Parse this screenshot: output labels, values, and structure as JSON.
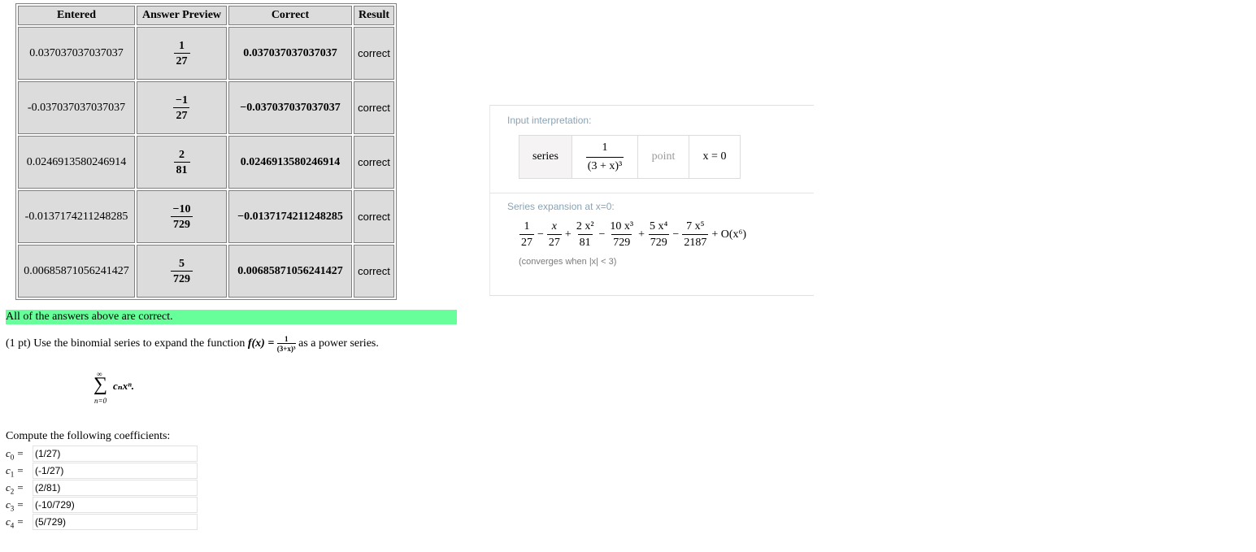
{
  "table": {
    "headers": [
      "Entered",
      "Answer Preview",
      "Correct",
      "Result"
    ],
    "rows": [
      {
        "entered": "0.037037037037037",
        "preview_num": "1",
        "preview_den": "27",
        "correct": "0.037037037037037",
        "result": "correct"
      },
      {
        "entered": "-0.037037037037037",
        "preview_num": "−1",
        "preview_den": "27",
        "correct": "−0.037037037037037",
        "result": "correct"
      },
      {
        "entered": "0.0246913580246914",
        "preview_num": "2",
        "preview_den": "81",
        "correct": "0.0246913580246914",
        "result": "correct"
      },
      {
        "entered": "-0.0137174211248285",
        "preview_num": "−10",
        "preview_den": "729",
        "correct": "−0.0137174211248285",
        "result": "correct"
      },
      {
        "entered": "0.00685871056241427",
        "preview_num": "5",
        "preview_den": "729",
        "correct": "0.00685871056241427",
        "result": "correct"
      }
    ]
  },
  "message": "All of the answers above are correct.",
  "problem": {
    "prefix": "(1 pt) Use the binomial series to expand the function ",
    "func": "f(x) = ",
    "func_num": "1",
    "func_den": "(3+x)³",
    "suffix": " as a power series.",
    "sum_upper": "∞",
    "sum_lower": "n=0",
    "sum_term": "cₙxⁿ."
  },
  "compute_label": "Compute the following coefficients:",
  "coefficients": [
    {
      "label": "c",
      "sub": "0",
      "value": "(1/27)"
    },
    {
      "label": "c",
      "sub": "1",
      "value": "(-1/27)"
    },
    {
      "label": "c",
      "sub": "2",
      "value": "(2/81)"
    },
    {
      "label": "c",
      "sub": "3",
      "value": "(-10/729)"
    },
    {
      "label": "c",
      "sub": "4",
      "value": "(5/729)"
    }
  ],
  "wolfram": {
    "pod1_title": "Input interpretation:",
    "interp": {
      "series": "series",
      "expr_num": "1",
      "expr_den": "(3 + x)³",
      "point": "point",
      "point_value": "x = 0"
    },
    "pod2_title": "Series expansion at x=0:",
    "terms": [
      {
        "op": "",
        "num": "1",
        "den": "27"
      },
      {
        "op": "−",
        "num": "x",
        "den": "27"
      },
      {
        "op": "+",
        "num": "2 x²",
        "den": "81"
      },
      {
        "op": "−",
        "num": "10 x³",
        "den": "729"
      },
      {
        "op": "+",
        "num": "5 x⁴",
        "den": "729"
      },
      {
        "op": "−",
        "num": "7 x⁵",
        "den": "2187"
      }
    ],
    "tail": "+ O(x⁶)",
    "converges": "(converges when |x| < 3)"
  }
}
